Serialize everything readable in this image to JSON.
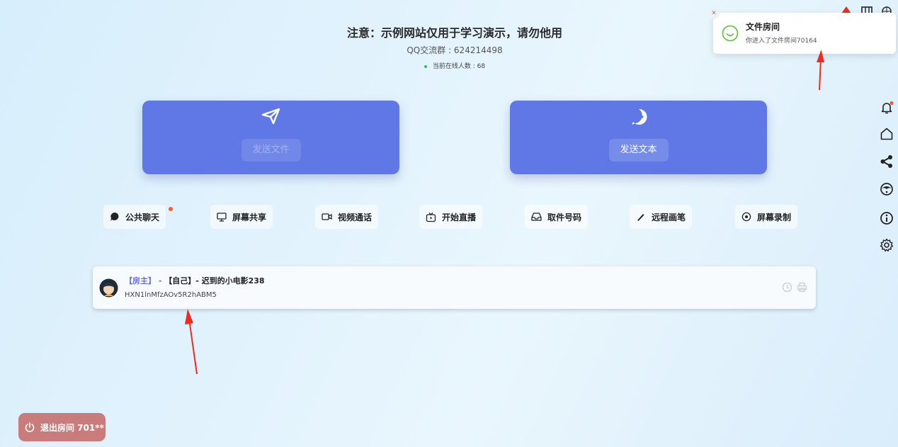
{
  "header": {
    "notice": "注意：示例网站仅用于学习演示，请勿他用",
    "qq_group": "QQ交流群 : 624214498",
    "online_count": "当前在线人数 : 68"
  },
  "cards": {
    "send_file": "发送文件",
    "send_text": "发送文本"
  },
  "toolbar": {
    "public_chat": "公共聊天",
    "screen_share": "屏幕共享",
    "video_call": "视频通话",
    "start_live": "开始直播",
    "pickup_code": "取件号码",
    "remote_pen": "远程画笔",
    "screen_record": "屏幕录制"
  },
  "user": {
    "role": "【房主】 - ",
    "name": "【自己】- 迟到的小电影238",
    "id": "HXN1lnMfzAOv5R2hABM5"
  },
  "notification": {
    "title": "文件房间",
    "message": "你进入了文件房间70164"
  },
  "exit_button": "退出房间 701**",
  "colors": {
    "card": "#5f78e6",
    "accent_dot": "#ff5a2b",
    "online_dot": "#27c93f",
    "exit": "#c97c7c",
    "arrow": "#f02a1e"
  }
}
